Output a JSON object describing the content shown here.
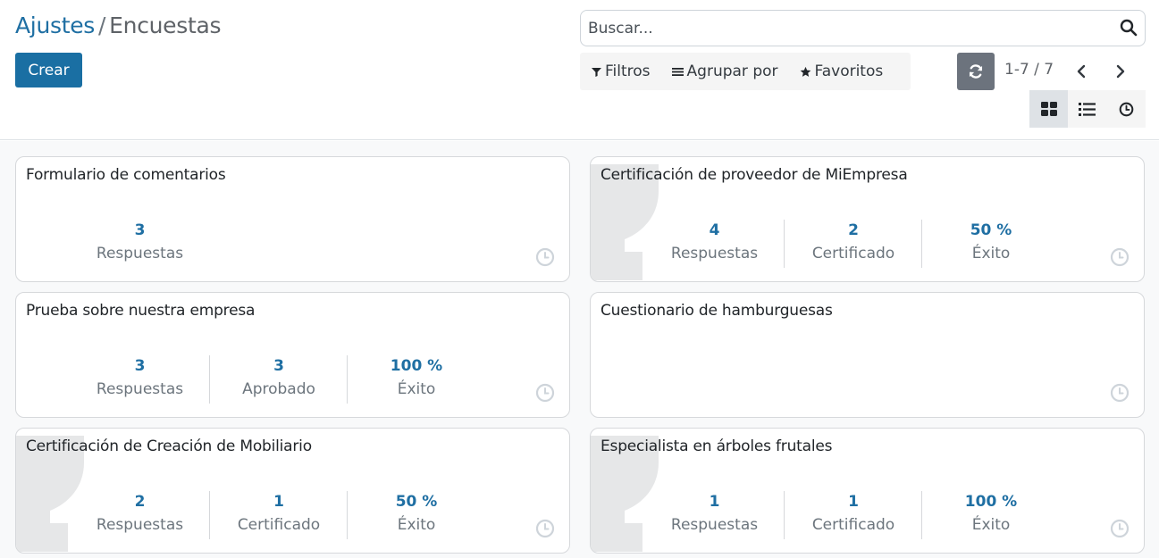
{
  "breadcrumb": {
    "parent": "Ajustes",
    "separator": "/",
    "current": "Encuestas"
  },
  "toolbar": {
    "create_label": "Crear"
  },
  "search": {
    "placeholder": "Buscar..."
  },
  "filters": {
    "filters_label": "Filtros",
    "group_by_label": "Agrupar por",
    "favorites_label": "Favoritos"
  },
  "pager": {
    "value": "1-7 / 7"
  },
  "views": [
    "kanban",
    "list",
    "activity"
  ],
  "colors": {
    "primary": "#1a6fa3",
    "accent_value": "#1f6fa3",
    "refresh": "#6c737d"
  },
  "cards": [
    {
      "title": "Formulario de comentarios",
      "certification": false,
      "stats": [
        {
          "value": "3",
          "label": "Respuestas"
        }
      ]
    },
    {
      "title": "Certificación de proveedor de MiEmpresa",
      "certification": true,
      "stats": [
        {
          "value": "4",
          "label": "Respuestas"
        },
        {
          "value": "2",
          "label": "Certificado"
        },
        {
          "value": "50 %",
          "label": "Éxito"
        }
      ]
    },
    {
      "title": "Prueba sobre nuestra empresa",
      "certification": false,
      "stats": [
        {
          "value": "3",
          "label": "Respuestas"
        },
        {
          "value": "3",
          "label": "Aprobado"
        },
        {
          "value": "100 %",
          "label": "Éxito"
        }
      ]
    },
    {
      "title": "Cuestionario de hamburguesas",
      "certification": false,
      "stats": []
    },
    {
      "title": "Certificación de Creación de Mobiliario",
      "certification": true,
      "stats": [
        {
          "value": "2",
          "label": "Respuestas"
        },
        {
          "value": "1",
          "label": "Certificado"
        },
        {
          "value": "50 %",
          "label": "Éxito"
        }
      ]
    },
    {
      "title": "Especialista en árboles frutales",
      "certification": true,
      "stats": [
        {
          "value": "1",
          "label": "Respuestas"
        },
        {
          "value": "1",
          "label": "Certificado"
        },
        {
          "value": "100 %",
          "label": "Éxito"
        }
      ]
    }
  ]
}
